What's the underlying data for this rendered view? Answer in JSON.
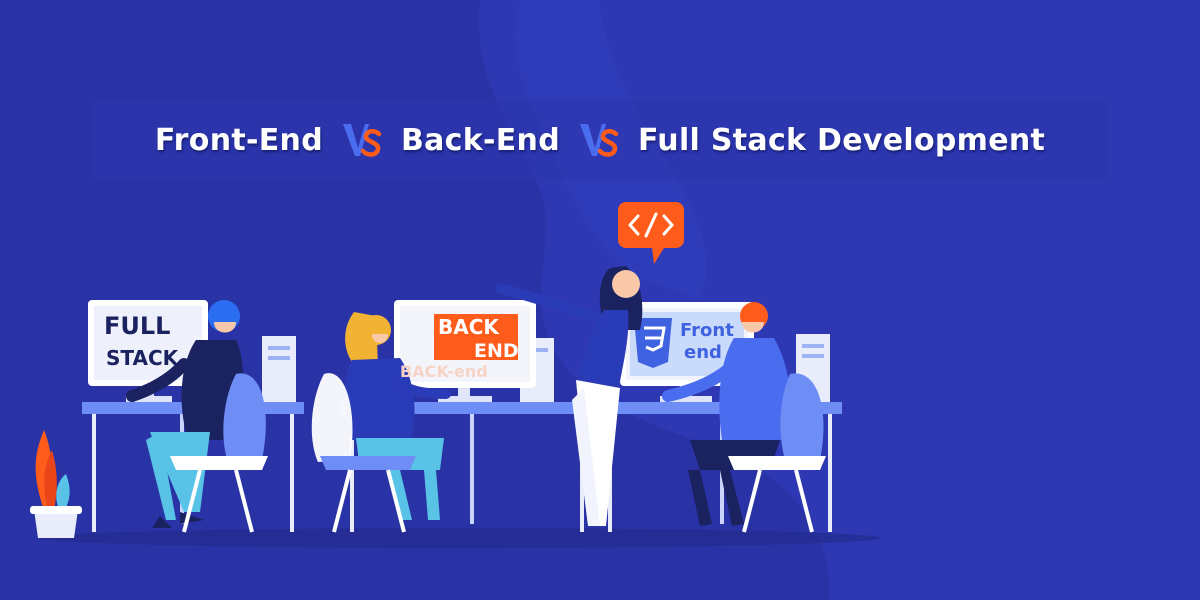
{
  "banner": {
    "title_parts": {
      "first": "Front-End",
      "second": "Back-End",
      "third": "Full Stack Development"
    },
    "separator_icon": "vs-glyph-icon",
    "code_bubble_icon": "code-brackets-icon"
  },
  "screens": {
    "left": {
      "line1": "FULL",
      "line2": "STACK"
    },
    "middle": {
      "line1": "BACK",
      "line2": "END",
      "caption": "BACK-end"
    },
    "right": {
      "logo_icon": "css3-shield-icon",
      "line1": "Front",
      "line2": "end"
    }
  },
  "colors": {
    "background": "#2a33a6",
    "accent_orange": "#ff5b1a",
    "accent_blue": "#4a6df0",
    "text_white": "#ffffff",
    "navy": "#1b2260"
  }
}
